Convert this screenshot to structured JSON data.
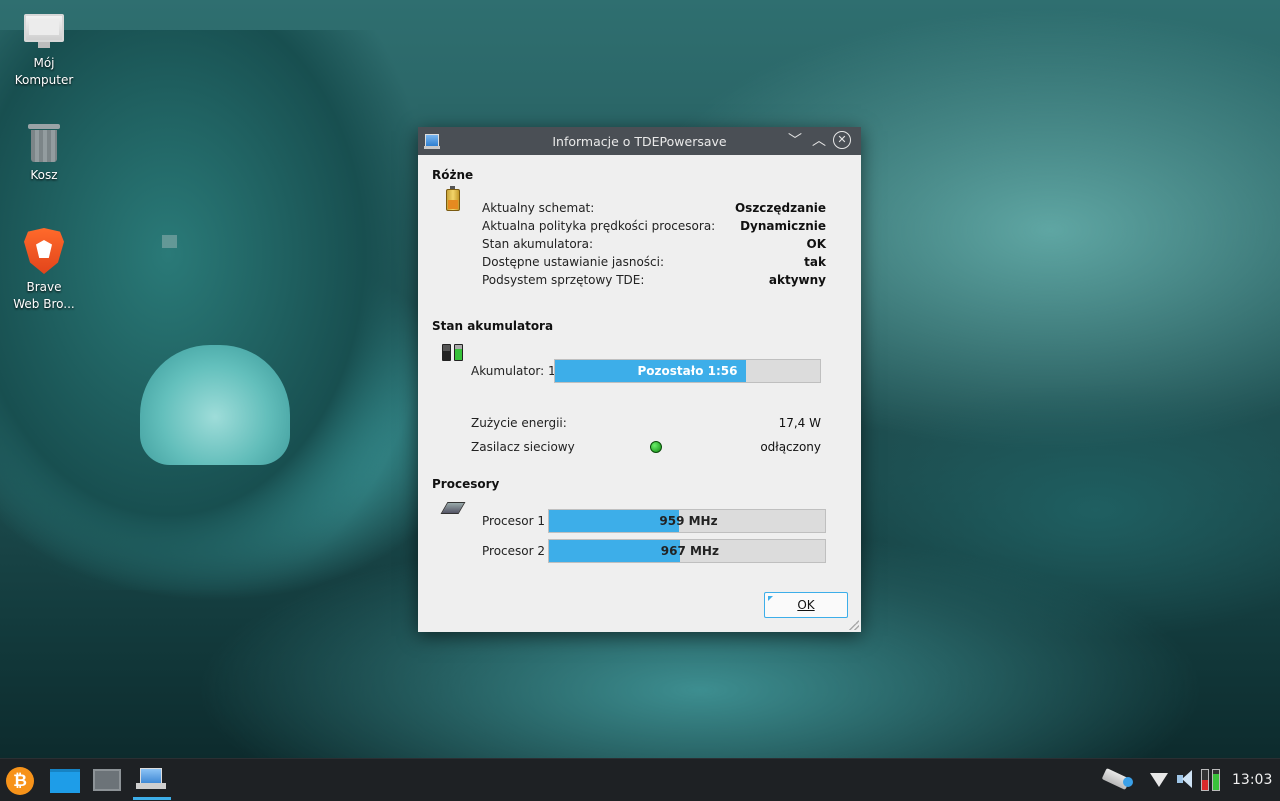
{
  "desktop": {
    "icons": [
      {
        "label_line1": "Mój",
        "label_line2": "Komputer"
      },
      {
        "label_line1": "Kosz",
        "label_line2": ""
      },
      {
        "label_line1": "Brave",
        "label_line2": "Web Bro..."
      }
    ]
  },
  "window": {
    "title": "Informacje o TDEPowersave",
    "controls": {
      "minimize": "﹀",
      "maximize": "︿",
      "close": "✕"
    },
    "misc": {
      "heading": "Różne",
      "rows": [
        {
          "label": "Aktualny schemat:",
          "value": "Oszczędzanie"
        },
        {
          "label": "Aktualna polityka prędkości procesora:",
          "value": "Dynamicznie"
        },
        {
          "label": "Stan akumulatora:",
          "value": "OK"
        },
        {
          "label": "Dostępne ustawianie jasności:",
          "value": "tak"
        },
        {
          "label": "Podsystem sprzętowy TDE:",
          "value": "aktywny"
        }
      ]
    },
    "battery": {
      "heading": "Stan akumulatora",
      "battery_label": "Akumulator: 1",
      "bar_text": "Pozostało 1:56",
      "bar_fraction": 0.72,
      "power_label": "Zużycie energii:",
      "power_value": "17,4 W",
      "ac_label": "Zasilacz sieciowy",
      "ac_value": "odłączony"
    },
    "cpus": {
      "heading": "Procesory",
      "items": [
        {
          "label": "Procesor 1",
          "value": "959 MHz",
          "fraction": 0.47
        },
        {
          "label": "Procesor 2",
          "value": "967 MHz",
          "fraction": 0.475
        }
      ]
    },
    "ok_button": "OK"
  },
  "taskbar": {
    "bitcoin_symbol": "₿",
    "clock": "13:03"
  },
  "colors": {
    "accent": "#3daee9",
    "titlebar": "#4a4f55",
    "taskbar": "#1e2124"
  }
}
